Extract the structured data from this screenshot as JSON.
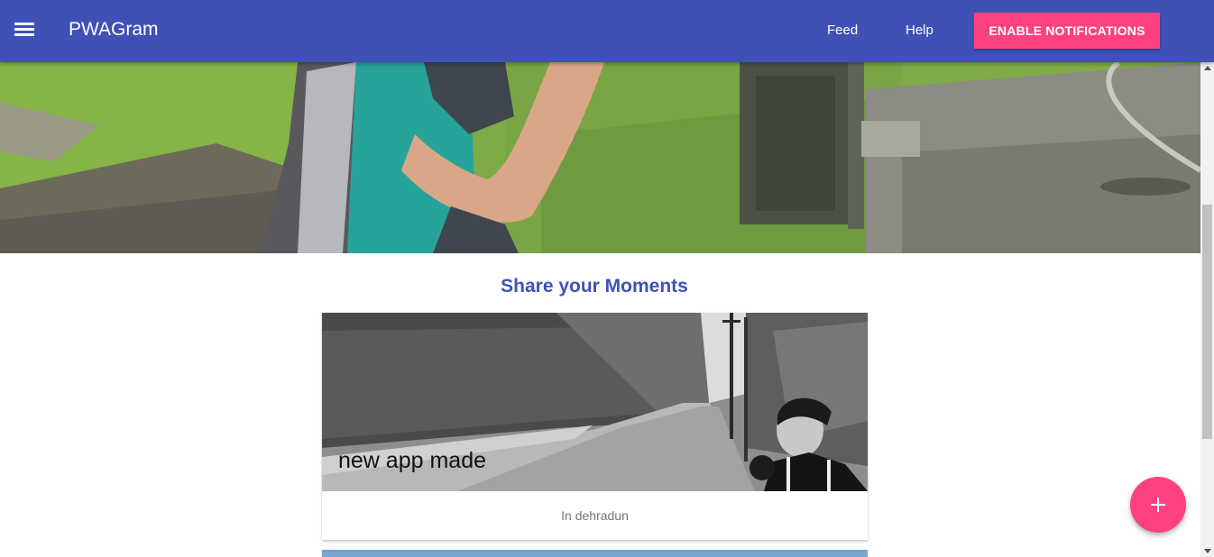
{
  "header": {
    "app_title": "PWAGram",
    "menu_icon": "hamburger-menu-icon",
    "nav": [
      {
        "label": "Feed"
      },
      {
        "label": "Help"
      }
    ],
    "notifications_button": "ENABLE NOTIFICATIONS",
    "colors": {
      "bar": "#3f51b5",
      "accent": "#ff4081"
    }
  },
  "main": {
    "section_title": "Share your Moments",
    "posts": [
      {
        "title": "new app made",
        "location": "In dehradun"
      }
    ]
  },
  "fab": {
    "icon": "plus-icon",
    "color": "#ff4081"
  }
}
